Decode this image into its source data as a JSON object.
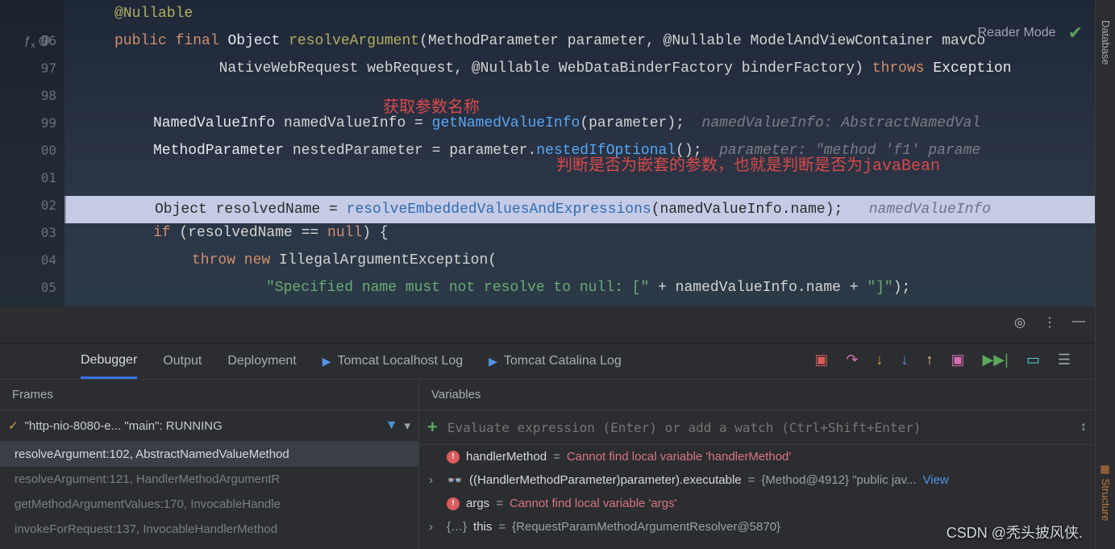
{
  "gutter": [
    "",
    "96",
    "97",
    "98",
    "99",
    "00",
    "01",
    "02",
    "03",
    "04",
    "05"
  ],
  "code": {
    "l1": "@Nullable",
    "l2_pub": "public ",
    "l2_final": "final ",
    "l2_obj": "Object ",
    "l2_method": "resolveArgument",
    "l2_rest": "(MethodParameter parameter, @Nullable ModelAndViewContainer mavCo",
    "l3_a": "            NativeWebRequest webRequest, @Nullable WebDataBinderFactory binderFactory) ",
    "l3_throws": "throws",
    "l3_exc": " Exception",
    "l5_type": "NamedValueInfo ",
    "l5_var": "namedValueInfo = ",
    "l5_m": "getNamedValueInfo",
    "l5_r": "(parameter);",
    "l5_h": "  namedValueInfo: AbstractNamedVal",
    "l6_type": "MethodParameter ",
    "l6_var": "nestedParameter = parameter.",
    "l6_m": "nestedIfOptional",
    "l6_r": "();",
    "l6_h": "  parameter: \"method 'f1' parame",
    "l8_a": "Object resolvedName = ",
    "l8_m": "resolveEmbeddedValuesAndExpressions",
    "l8_b": "(namedValueInfo.name);",
    "l8_h": "   namedValueInfo",
    "l9_if": "if ",
    "l9_r": "(resolvedName == ",
    "l9_null": "null",
    "l9_e": ") {",
    "l10_a": "throw new ",
    "l10_b": "IllegalArgumentException(",
    "l11_str": "\"Specified name must not resolve to null: [\"",
    "l11_a": " + namedValueInfo.name + ",
    "l11_str2": "\"]\"",
    "l11_e": ");",
    "red1": "获取参数名称",
    "red2": "判断是否为嵌套的参数，也就是判断是否为javaBean"
  },
  "reader_mode": "Reader Mode",
  "right_bar": {
    "database": "Database",
    "structure": "Structure"
  },
  "panel": {
    "tabs": {
      "debugger": "Debugger",
      "output": "Output",
      "deployment": "Deployment",
      "tomcat1": "Tomcat Localhost Log",
      "tomcat2": "Tomcat Catalina Log"
    },
    "frames": {
      "header": "Frames",
      "thread": "\"http-nio-8080-e... \"main\": RUNNING",
      "items": [
        "resolveArgument:102, AbstractNamedValueMethod",
        "resolveArgument:121, HandlerMethodArgumentR",
        "getMethodArgumentValues:170, InvocableHandle",
        "invokeForRequest:137, InvocableHandlerMethod"
      ]
    },
    "vars": {
      "header": "Variables",
      "eval_ph": "Evaluate expression (Enter) or add a watch (Ctrl+Shift+Enter)",
      "rows": [
        {
          "icon": "err",
          "name": "handlerMethod",
          "val": "Cannot find local variable 'handlerMethod'"
        },
        {
          "icon": "watch",
          "name": "((HandlerMethodParameter)parameter).executable",
          "val": "{Method@4912} \"public jav...",
          "link": "View"
        },
        {
          "icon": "err",
          "name": "args",
          "val": "Cannot find local variable 'args'"
        },
        {
          "icon": "obj",
          "name": "this",
          "val": "{RequestParamMethodArgumentResolver@5870}"
        }
      ]
    }
  },
  "watermark": "CSDN @秃头披风侠."
}
